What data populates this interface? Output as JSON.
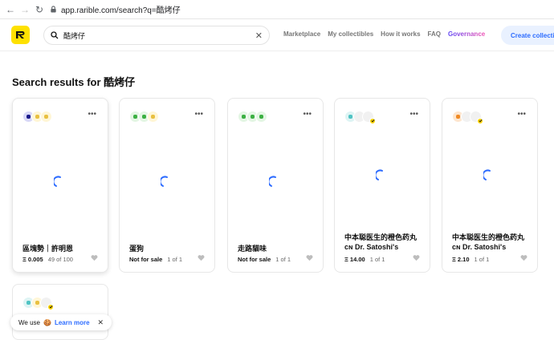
{
  "browser": {
    "url": "app.rarible.com/search?q=酷烤仔"
  },
  "header": {
    "search_value": "酷烤仔",
    "nav": [
      "Marketplace",
      "My collectibles",
      "How it works",
      "FAQ",
      "Governance"
    ],
    "create_label": "Create collecti"
  },
  "page": {
    "title": "Search results for 酷烤仔"
  },
  "cards": [
    {
      "name": "區塊勢｜許明恩",
      "price": "Ξ 0.005",
      "stock": "49 of 100",
      "avatar_colors": [
        "#1a1a8a",
        "#e8c040",
        "#e8c040"
      ]
    },
    {
      "name": "蛋狗",
      "price": "Not for sale",
      "stock": "1 of 1",
      "avatar_colors": [
        "#3cb043",
        "#3cb043",
        "#e8c040"
      ]
    },
    {
      "name": "走路貓味",
      "price": "Not for sale",
      "stock": "1 of 1",
      "avatar_colors": [
        "#3cb043",
        "#3cb043",
        "#3cb043"
      ]
    },
    {
      "name": "中本聪医生的橙色药丸",
      "name2": "ᴄɴ Dr. Satoshi's",
      "price": "Ξ 14.00",
      "stock": "1 of 1",
      "avatar_colors": [
        "#4fc3c3",
        "#dddddd",
        "#dddddd"
      ]
    },
    {
      "name": "中本聪医生的橙色药丸",
      "name2": "ᴄɴ Dr. Satoshi's",
      "price": "Ξ 2.10",
      "stock": "1 of 1",
      "avatar_colors": [
        "#f08a24",
        "#dddddd",
        "#dddddd"
      ]
    }
  ],
  "cookie": {
    "text": "We use",
    "emoji": "🍪",
    "learn_more": "Learn more",
    "close": "✕"
  }
}
